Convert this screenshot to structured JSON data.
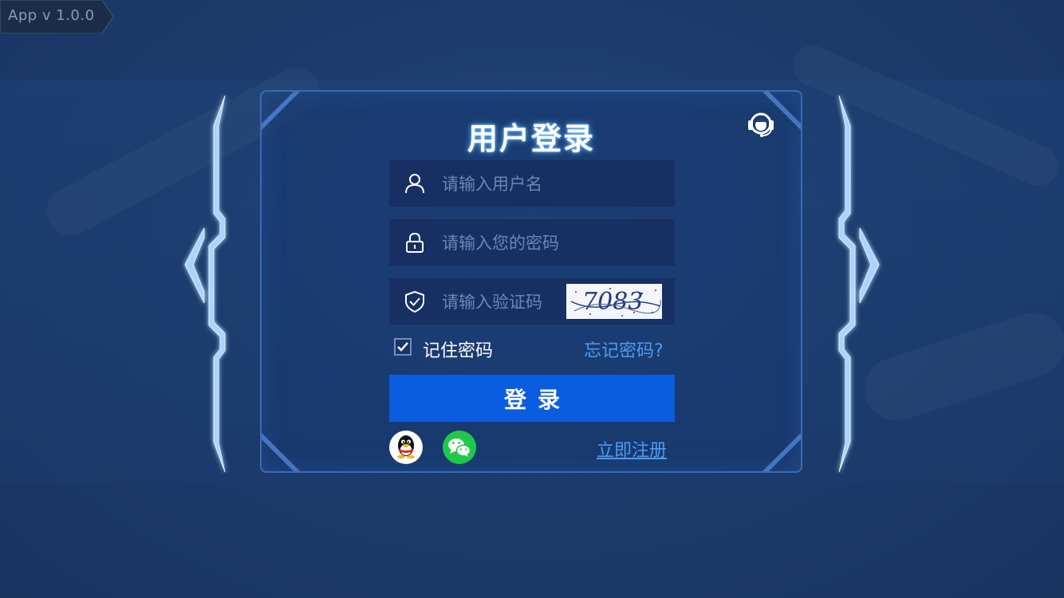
{
  "app": {
    "version": "App v 1.0.0"
  },
  "login": {
    "title": "用户登录",
    "username_placeholder": "请输入用户名",
    "password_placeholder": "请输入您的密码",
    "captcha_placeholder": "请输入验证码",
    "captcha_text": "7083",
    "remember_label": "记住密码",
    "remember_checked": true,
    "forgot_label": "忘记密码?",
    "login_button": "登录",
    "register_label": "立即注册"
  },
  "icons": {
    "support": "customer-service-icon",
    "username": "user-icon",
    "password": "lock-icon",
    "captcha": "shield-check-icon",
    "qq": "qq-icon",
    "wechat": "wechat-icon"
  },
  "colors": {
    "accent": "#0b5ddf",
    "link": "#4d9bf2",
    "panel_border": "#3a6bb4",
    "field_bg": "#172f63",
    "wechat_green": "#20c84a"
  }
}
